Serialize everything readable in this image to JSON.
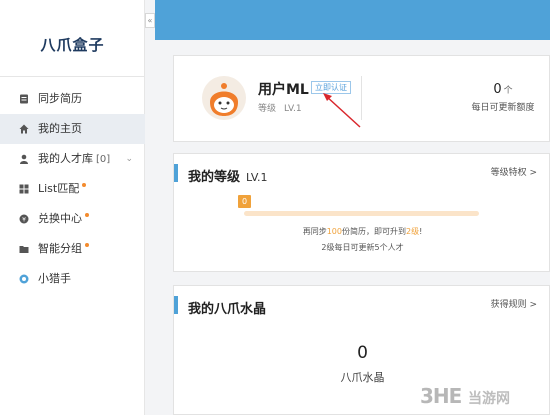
{
  "sidebar": {
    "logo": "八爪盒子",
    "items": [
      {
        "label": "同步简历",
        "icon": "resume-icon",
        "active": false
      },
      {
        "label": "我的主页",
        "icon": "home-icon",
        "active": true
      },
      {
        "label": "我的人才库",
        "count": "[0]",
        "icon": "person-icon",
        "active": false,
        "expandable": true
      },
      {
        "label": "List匹配",
        "icon": "grid-icon",
        "active": false,
        "dot": true
      },
      {
        "label": "兑换中心",
        "icon": "exchange-icon",
        "active": false,
        "dot": true
      },
      {
        "label": "智能分组",
        "icon": "folder-icon",
        "active": false,
        "dot": true
      },
      {
        "label": "小猎手",
        "icon": "hunter-icon",
        "active": false
      }
    ],
    "collapse_label": "«"
  },
  "profile": {
    "username": "用户ML",
    "verify_label": "立即认证",
    "level_label": "等级",
    "level_value": "LV.1",
    "quota_value": "0",
    "quota_unit": "个",
    "quota_label": "每日可更新额度"
  },
  "level_section": {
    "title": "我的等级",
    "level": "LV.1",
    "link": "等级特权 >",
    "progress_badge": "0",
    "progress": 0.0,
    "tip_prefix": "再同步",
    "tip_count": "100",
    "tip_middle": "份简历，即可升到",
    "tip_target": "2级",
    "tip_suffix": "!",
    "tip2": "2级每日可更新5个人才"
  },
  "crystal_section": {
    "title": "我的八爪水晶",
    "link": "获得规则 >",
    "value": "0",
    "label": "八爪水晶"
  },
  "watermark": {
    "logo": "3HE",
    "text": "当游网"
  },
  "colors": {
    "accent": "#4fa2d8",
    "orange": "#f0a23b",
    "red_arrow": "#d9262c"
  }
}
